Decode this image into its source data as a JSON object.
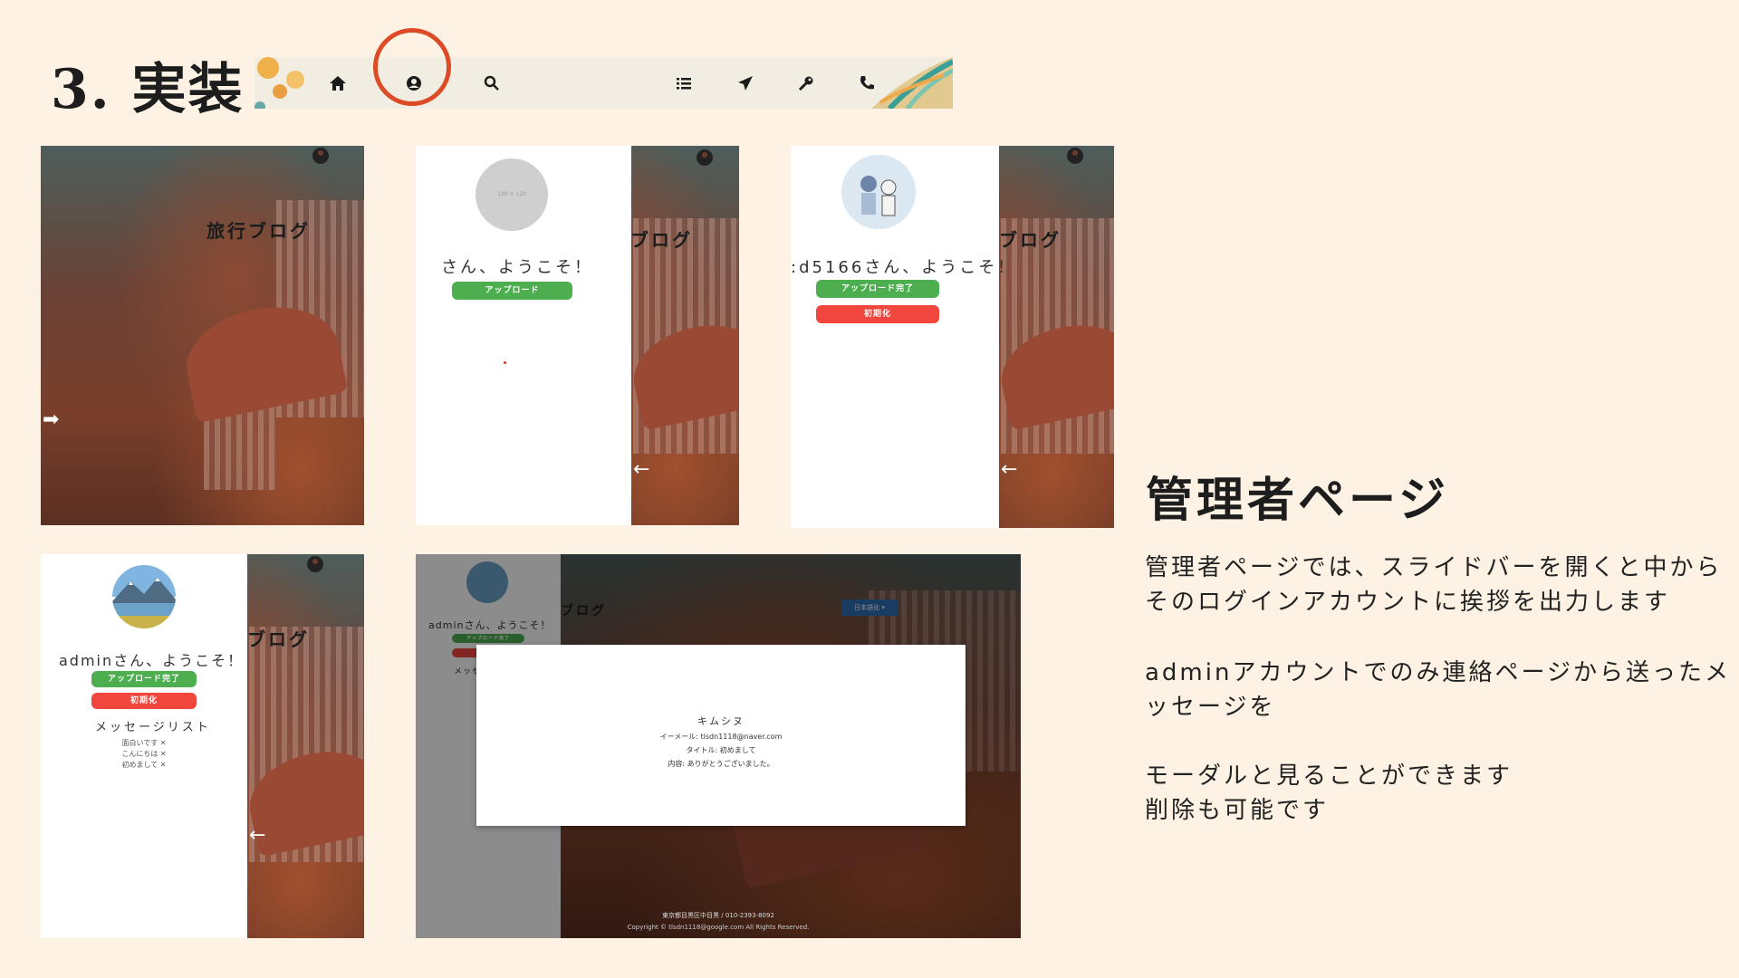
{
  "slide": {
    "title": "3. 実装",
    "section_heading": "管理者ページ",
    "description": [
      "管理者ページでは、スライドバーを開くと中から",
      "そのログインアカウントに挨拶を出力します",
      "adminアカウントでのみ連絡ページから送ったメ",
      "ッセージを",
      "モーダルと見ることができます",
      "削除も可能です"
    ]
  },
  "navbar": {
    "icons": [
      "home-icon",
      "user-circle-icon",
      "search-icon",
      "list-icon",
      "send-icon",
      "key-icon",
      "phone-icon"
    ],
    "highlighted": "user-circle-icon",
    "highlight_color": "#dc4a26"
  },
  "screens": {
    "screen1": {
      "title": "旅行ブログ"
    },
    "screen2": {
      "title_partial": "ブログ",
      "avatar_placeholder": "120 × 120",
      "greeting": "さん、ようこそ！",
      "upload_button": "アップロード"
    },
    "screen3": {
      "title_partial": "ブログ",
      "greeting": ":d5166さん、ようこそ！",
      "upload_done_button": "アップロード完了",
      "reset_button": "初期化"
    },
    "screen4": {
      "title_partial": "ブログ",
      "greeting": "adminさん、ようこそ！",
      "upload_done_button": "アップロード完了",
      "reset_button": "初期化",
      "message_list_title": "メッセージリスト",
      "messages": [
        "面白いです ✕",
        "こんにちは ✕",
        "初めまして ✕"
      ]
    },
    "screen5": {
      "greeting": "adminさん、ようこそ！",
      "title_partial": "ブログ",
      "upload_done_button": "アップロード完了",
      "message_partial": "メッセ",
      "language_button": "日本語化 ▾",
      "modal": {
        "name": "キムシヌ",
        "email": "イーメール: tlsdn1118@naver.com",
        "subject": "タイトル: 初めまして",
        "content": "内容: ありがとうございました。"
      },
      "footer_address": "東京都目黒区中目黒 / 010-2393-8092",
      "footer_copyright": "Copyright © tlsdn1118@google.com All Rights Reserved."
    }
  },
  "colors": {
    "background": "#fdf2e3",
    "green_button": "#4cae4f",
    "red_button": "#f0463e"
  }
}
